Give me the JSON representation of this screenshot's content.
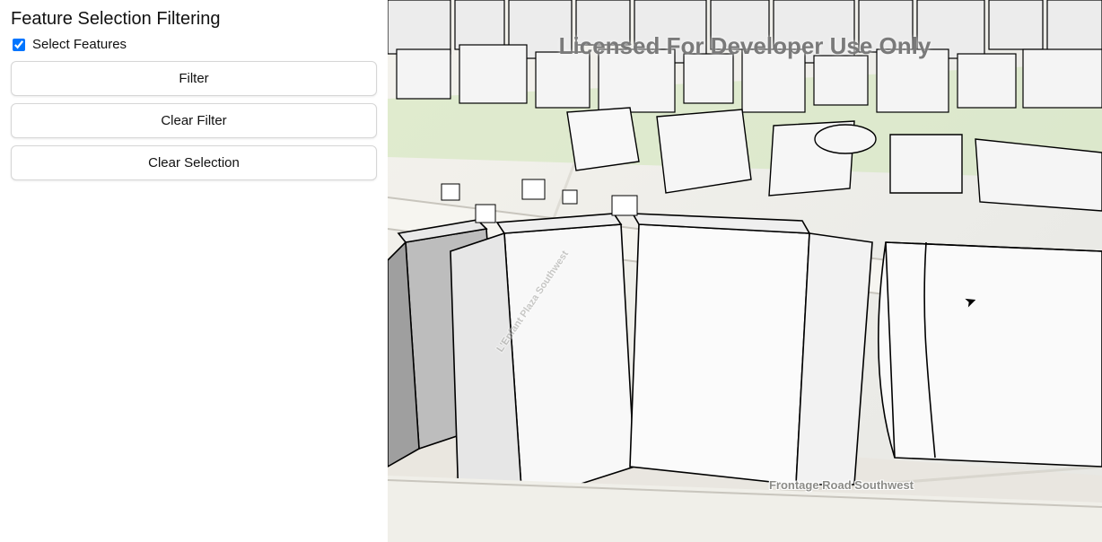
{
  "panel": {
    "title": "Feature Selection Filtering",
    "checkbox_label": "Select Features",
    "checkbox_checked": true,
    "buttons": {
      "filter": "Filter",
      "clear_filter": "Clear Filter",
      "clear_selection": "Clear Selection"
    }
  },
  "scene": {
    "watermark": "Licensed For Developer Use Only",
    "roads": {
      "frontage": "Frontage Road Southwest",
      "lenfant": "L'Enfant Plaza Southwest"
    }
  }
}
